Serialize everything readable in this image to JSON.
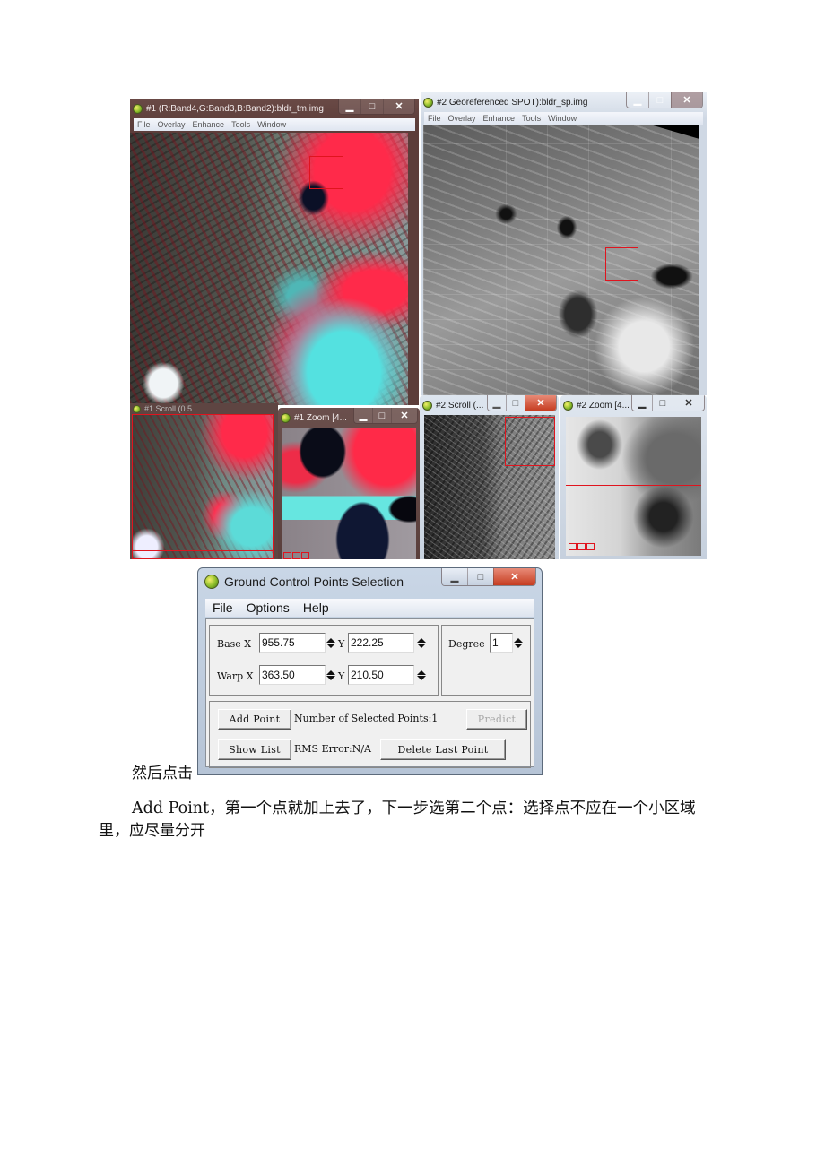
{
  "windows": {
    "tm": {
      "title": "#1 (R:Band4,G:Band3,B:Band2):bldr_tm.img",
      "menu": [
        "File",
        "Overlay",
        "Enhance",
        "Tools",
        "Window"
      ],
      "controls": {
        "minimize": "▁",
        "maximize": "□",
        "close": "✕"
      }
    },
    "sp": {
      "title": "#2 Georeferenced SPOT):bldr_sp.img",
      "menu": [
        "File",
        "Overlay",
        "Enhance",
        "Tools",
        "Window"
      ],
      "controls": {
        "minimize": "▁",
        "maximize": "□",
        "close": "✕"
      }
    },
    "scroll1": {
      "title": "#1 Scroll (0.5..."
    },
    "zoom1": {
      "title": "#1 Zoom [4...",
      "controls": {
        "minimize": "▁",
        "maximize": "□",
        "close": "✕"
      }
    },
    "scroll2": {
      "title": "#2 Scroll (...",
      "controls": {
        "minimize": "▁",
        "maximize": "□",
        "close": "✕"
      }
    },
    "zoom2": {
      "title": "#2 Zoom [4...",
      "controls": {
        "minimize": "▁",
        "maximize": "□",
        "close": "✕"
      }
    }
  },
  "gcp_dialog": {
    "title": "Ground Control Points Selection",
    "controls": {
      "minimize": "▁",
      "maximize": "□",
      "close": "✕"
    },
    "menu": [
      "File",
      "Options",
      "Help"
    ],
    "base_label": "Base X",
    "warp_label": "Warp X",
    "y_label": "Y",
    "base_x": "955.75",
    "base_y": "222.25",
    "warp_x": "363.50",
    "warp_y": "210.50",
    "degree_label": "Degree",
    "degree_value": "1",
    "add_point": "Add Point",
    "selected_points_label": "Number of Selected Points:",
    "selected_points_value": "1",
    "predict": "Predict",
    "show_list": "Show List",
    "rms_label": "RMS Error:",
    "rms_value": "N/A",
    "delete_last": "Delete Last Point"
  },
  "text": {
    "line1_prefix": "然后点击",
    "line2": "Add Point，第一个点就加上去了，下一步选第二个点：选择点不应在一个小区域",
    "line3": "里，应尽量分开"
  }
}
